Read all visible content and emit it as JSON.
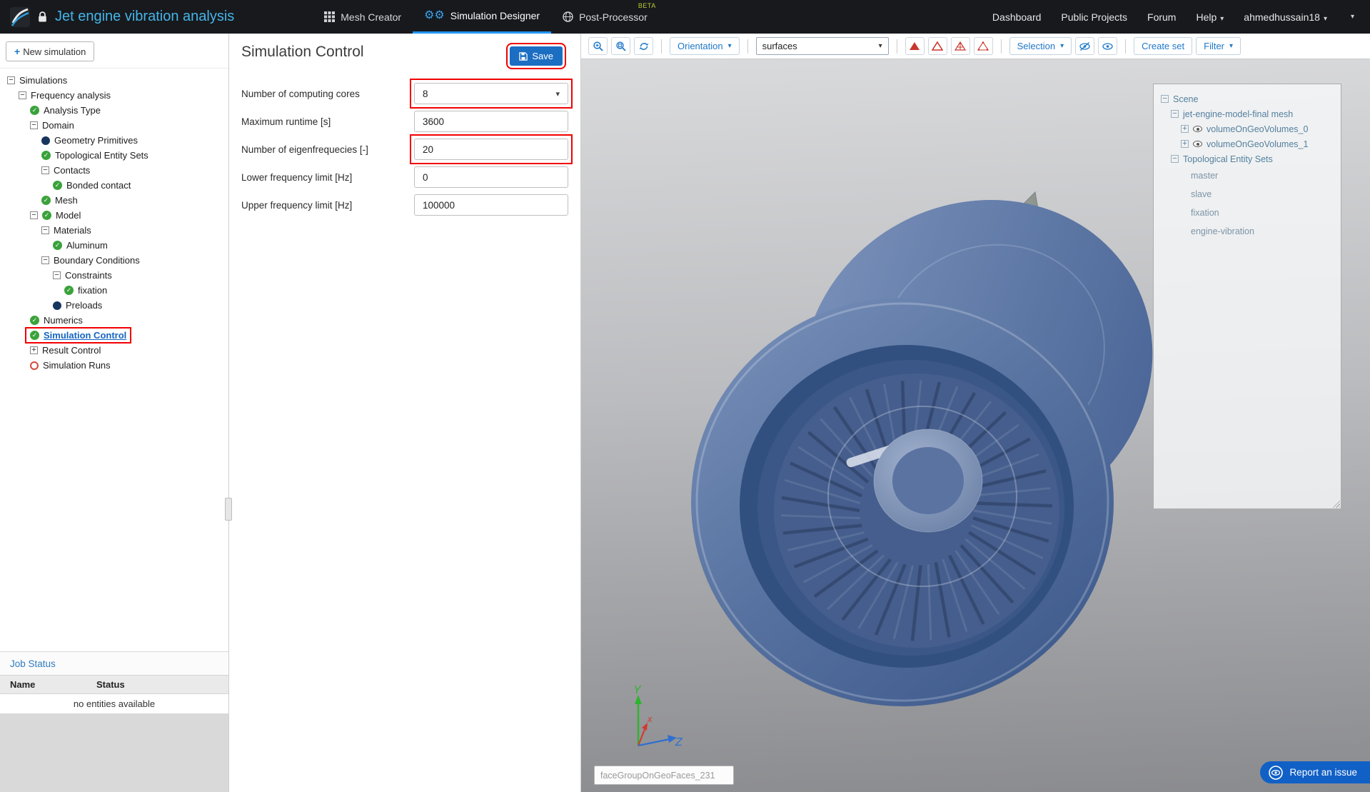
{
  "navbar": {
    "title": "Jet engine vibration analysis",
    "tabs": [
      {
        "label": "Mesh Creator"
      },
      {
        "label": "Simulation Designer"
      },
      {
        "label": "Post-Processor",
        "badge": "BETA"
      }
    ],
    "links": [
      "Dashboard",
      "Public Projects",
      "Forum",
      "Help"
    ],
    "user": "ahmedhussain18"
  },
  "sidebar": {
    "new_simulation": "New simulation",
    "tree": [
      {
        "label": "Simulations",
        "expander": "minus",
        "indent": 0
      },
      {
        "label": "Frequency analysis",
        "expander": "minus",
        "indent": 1
      },
      {
        "label": "Analysis Type",
        "icon": "check",
        "indent": 2
      },
      {
        "label": "Domain",
        "expander": "minus",
        "indent": 2
      },
      {
        "label": "Geometry Primitives",
        "icon": "dot",
        "indent": 3
      },
      {
        "label": "Topological Entity Sets",
        "icon": "check",
        "indent": 3
      },
      {
        "label": "Contacts",
        "expander": "minus",
        "indent": 3
      },
      {
        "label": "Bonded contact",
        "icon": "check",
        "indent": 4
      },
      {
        "label": "Mesh",
        "icon": "check",
        "indent": 3
      },
      {
        "label": "Model",
        "expander": "minus",
        "icon": "check",
        "indent": 2
      },
      {
        "label": "Materials",
        "expander": "minus",
        "indent": 3
      },
      {
        "label": "Aluminum",
        "icon": "check",
        "indent": 4
      },
      {
        "label": "Boundary Conditions",
        "expander": "minus",
        "indent": 3
      },
      {
        "label": "Constraints",
        "expander": "minus",
        "indent": 4
      },
      {
        "label": "fixation",
        "icon": "check",
        "indent": 5
      },
      {
        "label": "Preloads",
        "icon": "dot",
        "indent": 4
      },
      {
        "label": "Numerics",
        "icon": "check",
        "indent": 2
      },
      {
        "label": "Simulation Control",
        "icon": "check",
        "indent": 2,
        "highlighted": true
      },
      {
        "label": "Result Control",
        "expander": "plus",
        "indent": 2
      },
      {
        "label": "Simulation Runs",
        "icon": "circle",
        "indent": 2
      }
    ],
    "job_status": {
      "title": "Job Status",
      "columns": [
        "Name",
        "Status"
      ],
      "empty_text": "no entities available"
    }
  },
  "panel": {
    "title": "Simulation Control",
    "save": "Save",
    "fields": [
      {
        "label": "Number of computing cores",
        "value": "8",
        "type": "select",
        "highlighted": true
      },
      {
        "label": "Maximum runtime [s]",
        "value": "3600",
        "type": "input"
      },
      {
        "label": "Number of eigenfrequecies [-]",
        "value": "20",
        "type": "input",
        "highlighted": true
      },
      {
        "label": "Lower frequency limit [Hz]",
        "value": "0",
        "type": "input"
      },
      {
        "label": "Upper frequency limit [Hz]",
        "value": "100000",
        "type": "input"
      }
    ]
  },
  "viewer": {
    "toolbar": {
      "orientation": "Orientation",
      "render_mode": "surfaces",
      "selection": "Selection",
      "create_set": "Create set",
      "filter": "Filter"
    },
    "scene_tree": [
      {
        "label": "Scene",
        "expander": "minus",
        "indent": 0
      },
      {
        "label": "jet-engine-model-final mesh",
        "expander": "minus",
        "indent": 1
      },
      {
        "label": "volumeOnGeoVolumes_0",
        "expander": "plus",
        "eye": true,
        "indent": 2
      },
      {
        "label": "volumeOnGeoVolumes_1",
        "expander": "plus",
        "eye": true,
        "indent": 2
      },
      {
        "label": "Topological Entity Sets",
        "expander": "minus",
        "indent": 1
      },
      {
        "label": "master",
        "indent": 2
      },
      {
        "label": "slave",
        "indent": 2
      },
      {
        "label": "fixation",
        "indent": 2
      },
      {
        "label": "engine-vibration",
        "indent": 2
      }
    ],
    "axes": {
      "y": "Y",
      "x": "x",
      "z": "Z"
    },
    "face_group_value": "faceGroupOnGeoFaces_231",
    "report_issue": "Report an issue",
    "colors": {
      "accent_blue": "#1e78c8",
      "annotation_red": "#f20000",
      "engine_blue": "#46608f",
      "fin_gray": "#a8aea9"
    }
  }
}
